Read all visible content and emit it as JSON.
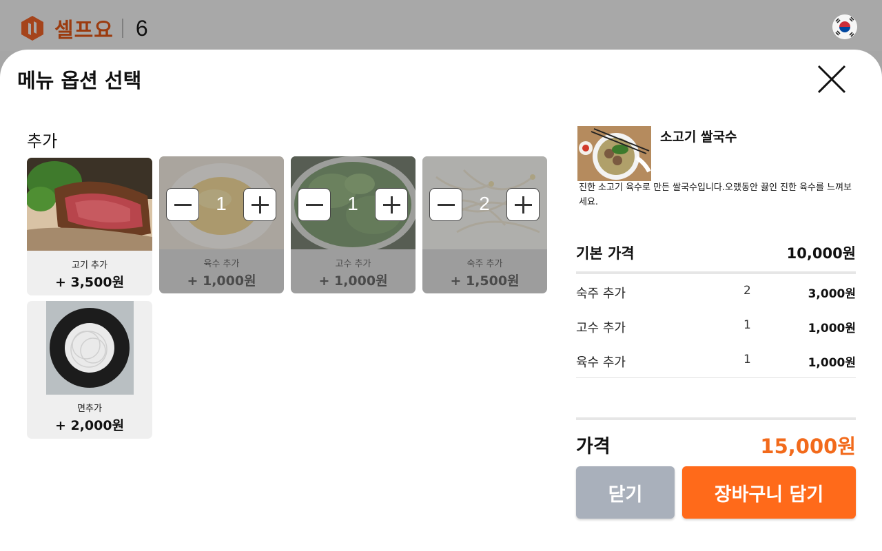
{
  "header": {
    "logo_text": "셀프요",
    "table_number": "6",
    "language_flag_icon": "korea-flag-icon"
  },
  "modal": {
    "title": "메뉴 옵션 선택",
    "close_icon": "close-icon",
    "section_title": "추가",
    "options": [
      {
        "name": "고기 추가",
        "price": "+ 3,500원",
        "selected": false,
        "quantity": null,
        "image": "roast-beef-photo"
      },
      {
        "name": "육수 추가",
        "price": "+ 1,000원",
        "selected": true,
        "quantity": "1",
        "image": "broth-photo"
      },
      {
        "name": "고수 추가",
        "price": "+ 1,000원",
        "selected": true,
        "quantity": "1",
        "image": "cilantro-photo"
      },
      {
        "name": "숙주 추가",
        "price": "+ 1,500원",
        "selected": true,
        "quantity": "2",
        "image": "bean-sprouts-photo"
      },
      {
        "name": "면추가",
        "price": "+ 2,000원",
        "selected": false,
        "quantity": null,
        "image": "rice-noodles-photo"
      }
    ]
  },
  "summary": {
    "dish_name": "소고기 쌀국수",
    "dish_description": "진한 소고기 육수로 만든 쌀국수입니다.오랬동안 끓인 진한 육수를 느껴보세요.",
    "base_label": "기본 가격",
    "base_price": "10,000원",
    "items": [
      {
        "name": "숙주 추가",
        "qty": "2",
        "price": "3,000원"
      },
      {
        "name": "고수 추가",
        "qty": "1",
        "price": "1,000원"
      },
      {
        "name": "육수 추가",
        "qty": "1",
        "price": "1,000원"
      }
    ],
    "total_label": "가격",
    "total_price": "15,000원"
  },
  "buttons": {
    "close_label": "닫기",
    "cart_label": "장바구니 담기"
  },
  "colors": {
    "accent": "#ff6a1a",
    "total_price": "#f26a1b",
    "close_button": "#a9b0bb",
    "logo": "#9b3b0f"
  }
}
